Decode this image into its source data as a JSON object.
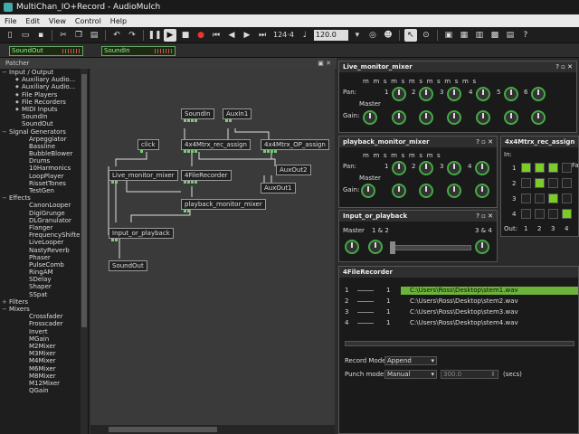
{
  "window": {
    "title": "MultiChan_IO+Record - AudioMulch"
  },
  "menu": [
    "File",
    "Edit",
    "View",
    "Control",
    "Help"
  ],
  "toolbar": {
    "tempo": "124·4",
    "bpm": "120.0"
  },
  "channels": {
    "out_label": "SoundOut",
    "in_label": "SoundIn"
  },
  "patcher": {
    "title": "Patcher",
    "controls": "▣ ✕"
  },
  "tree": [
    {
      "type": "cat",
      "label": "Input / Output"
    },
    {
      "type": "subd",
      "label": "Auxiliary Audio..."
    },
    {
      "type": "subd",
      "label": "Auxiliary Audio..."
    },
    {
      "type": "subd",
      "label": "File Players"
    },
    {
      "type": "subd",
      "label": "File Recorders"
    },
    {
      "type": "subd",
      "label": "MIDI Inputs"
    },
    {
      "type": "sub",
      "label": "SoundIn"
    },
    {
      "type": "sub",
      "label": "SoundOut"
    },
    {
      "type": "cat",
      "label": "Signal Generators"
    },
    {
      "type": "item",
      "label": "Arpeggiator"
    },
    {
      "type": "item",
      "label": "Bassline"
    },
    {
      "type": "item",
      "label": "BubbleBlower"
    },
    {
      "type": "item",
      "label": "Drums"
    },
    {
      "type": "item",
      "label": "10Harmonics"
    },
    {
      "type": "item",
      "label": "LoopPlayer"
    },
    {
      "type": "item",
      "label": "RissetTones"
    },
    {
      "type": "item",
      "label": "TestGen"
    },
    {
      "type": "cat",
      "label": "Effects"
    },
    {
      "type": "item",
      "label": "CanonLooper"
    },
    {
      "type": "item",
      "label": "DigiGrunge"
    },
    {
      "type": "item",
      "label": "DLGranulator"
    },
    {
      "type": "item",
      "label": "Flanger"
    },
    {
      "type": "item",
      "label": "FrequencyShifter"
    },
    {
      "type": "item",
      "label": "LiveLooper"
    },
    {
      "type": "item",
      "label": "NastyReverb"
    },
    {
      "type": "item",
      "label": "Phaser"
    },
    {
      "type": "item",
      "label": "PulseComb"
    },
    {
      "type": "item",
      "label": "RingAM"
    },
    {
      "type": "item",
      "label": "SDelay"
    },
    {
      "type": "item",
      "label": "Shaper"
    },
    {
      "type": "item",
      "label": "SSpat"
    },
    {
      "type": "catc",
      "label": "Filters"
    },
    {
      "type": "cat",
      "label": "Mixers"
    },
    {
      "type": "item",
      "label": "Crossfader"
    },
    {
      "type": "item",
      "label": "Frosscader"
    },
    {
      "type": "item",
      "label": "Invert"
    },
    {
      "type": "item",
      "label": "MGain"
    },
    {
      "type": "item",
      "label": "M2Mixer"
    },
    {
      "type": "item",
      "label": "M3Mixer"
    },
    {
      "type": "item",
      "label": "M4Mixer"
    },
    {
      "type": "item",
      "label": "M6Mixer"
    },
    {
      "type": "item",
      "label": "M8Mixer"
    },
    {
      "type": "item",
      "label": "M12Mixer"
    },
    {
      "type": "item",
      "label": "QGain"
    }
  ],
  "nodes": {
    "soundin": "SoundIn",
    "auxin1": "AuxIn1",
    "click": "click",
    "mtrx_rec": "4x4Mtrx_rec_assign",
    "mtrx_op": "4x4Mtrx_OP_assign",
    "live_mon": "Live_monitor_mixer",
    "recorder": "4FileRecorder",
    "auxout2": "AuxOut2",
    "auxout1": "AuxOut1",
    "pb_mon": "playback_monitor_mixer",
    "input_or_pb": "Input_or_playback",
    "soundout": "SoundOut"
  },
  "live_monitor_mixer": {
    "title": "Live_monitor_mixer",
    "controls": "? ▫ ✕",
    "ms": "m     m  s   m  s   m  s   m  s   m  s   m  s",
    "pan_label": "Pan:",
    "gain_label": "Gain:",
    "master_label": "Master",
    "channels": [
      "1",
      "2",
      "3",
      "4",
      "5",
      "6"
    ]
  },
  "playback_monitor_mixer": {
    "title": "playback_monitor_mixer",
    "controls": "? ▫ ✕",
    "ms": "m     m  s   m  s   m  s   m  s",
    "pan_label": "Pan:",
    "gain_label": "Gain:",
    "master_label": "Master",
    "channels": [
      "1",
      "2",
      "3",
      "4"
    ]
  },
  "matrix": {
    "title": "4x4Mtrx_rec_assign",
    "in_label": "In:",
    "out_label": "Out:",
    "fade_label": "Fa",
    "rows": [
      "1",
      "2",
      "3",
      "4"
    ],
    "cols": [
      "1",
      "2",
      "3",
      "4"
    ],
    "on": [
      [
        0,
        0
      ],
      [
        1,
        1
      ],
      [
        2,
        2
      ],
      [
        3,
        3
      ],
      [
        0,
        1
      ],
      [
        0,
        2
      ]
    ]
  },
  "input_or_playback": {
    "title": "Input_or_playback",
    "controls": "? ▫ ✕",
    "master_label": "Master",
    "left_label": "1 & 2",
    "right_label": "3 & 4"
  },
  "recorder": {
    "title": "4FileRecorder",
    "rows": [
      {
        "num": "1",
        "ch": "1",
        "path": "C:\\Users\\Ross\\Desktop\\stem1.wav"
      },
      {
        "num": "2",
        "ch": "1",
        "path": "C:\\Users\\Ross\\Desktop\\stem2.wav"
      },
      {
        "num": "3",
        "ch": "1",
        "path": "C:\\Users\\Ross\\Desktop\\stem3.wav"
      },
      {
        "num": "4",
        "ch": "1",
        "path": "C:\\Users\\Ross\\Desktop\\stem4.wav"
      }
    ],
    "record_mode_label": "Record Mode:",
    "record_mode_value": "Append",
    "punch_mode_label": "Punch mode:",
    "punch_mode_value": "Manual",
    "punch_time": "300.0",
    "secs_label": "(secs)"
  }
}
